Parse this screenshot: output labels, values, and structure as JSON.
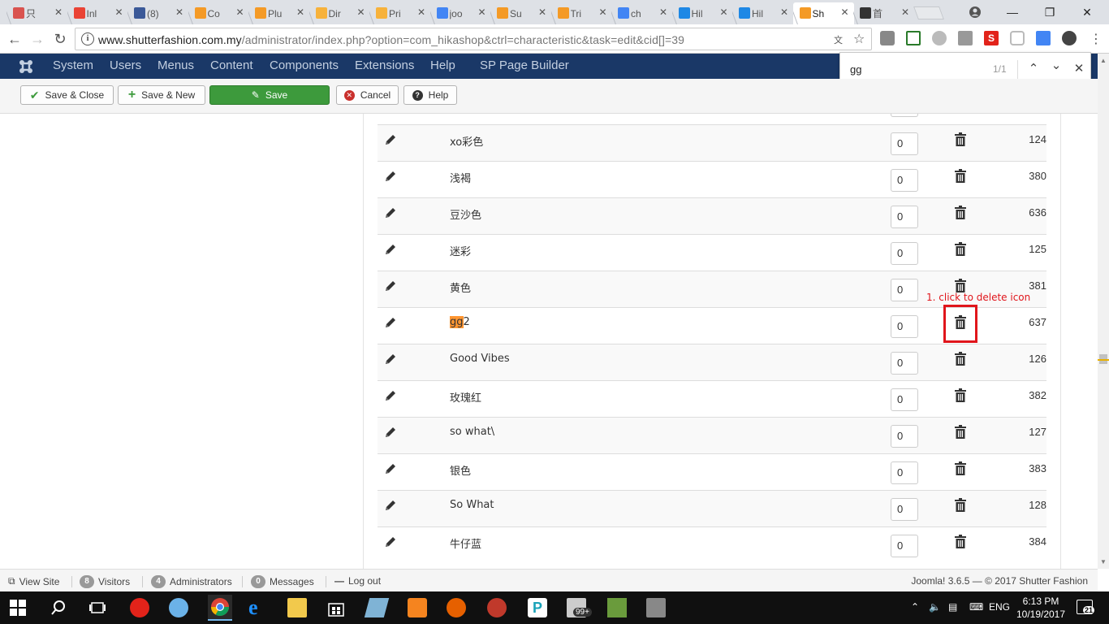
{
  "browser": {
    "tabs": [
      {
        "label": "只",
        "color": "#d9534f"
      },
      {
        "label": "Inl",
        "color": "#ea4335"
      },
      {
        "label": "(8)",
        "color": "#3b5998"
      },
      {
        "label": "Co",
        "color": "#f49a26"
      },
      {
        "label": "Plu",
        "color": "#f49a26"
      },
      {
        "label": "Dir",
        "color": "#f7b23b"
      },
      {
        "label": "Pri",
        "color": "#f7b23b"
      },
      {
        "label": "joo",
        "color": "#4285f4"
      },
      {
        "label": "Su",
        "color": "#f49a26"
      },
      {
        "label": "Tri",
        "color": "#f49a26"
      },
      {
        "label": "ch",
        "color": "#4285f4"
      },
      {
        "label": "Hil",
        "color": "#1e88e5"
      },
      {
        "label": "Hil",
        "color": "#1e88e5"
      },
      {
        "label": "Sh",
        "color": "#f49a26",
        "active": true
      },
      {
        "label": "首",
        "color": "#333333"
      }
    ],
    "url_host": "www.shutterfashion.com.my",
    "url_path": "/administrator/index.php?option=com_hikashop&ctrl=characteristic&task=edit&cid[]=39",
    "find": {
      "query": "gg",
      "count": "1/1"
    }
  },
  "admin_menu": {
    "items": [
      "System",
      "Users",
      "Menus",
      "Content",
      "Components",
      "Extensions",
      "Help",
      "SP Page Builder"
    ]
  },
  "toolbar": {
    "save_close": "Save & Close",
    "save_new": "Save & New",
    "save": "Save",
    "cancel": "Cancel",
    "help": "Help"
  },
  "values_table": {
    "rows": [
      {
        "name": "xo彩色",
        "ordering": "0",
        "id": "124"
      },
      {
        "name": "浅褐",
        "ordering": "0",
        "id": "380"
      },
      {
        "name": "豆沙色",
        "ordering": "0",
        "id": "636"
      },
      {
        "name": "迷彩",
        "ordering": "0",
        "id": "125"
      },
      {
        "name": "黄色",
        "ordering": "0",
        "id": "381"
      },
      {
        "name_highlight": "gg",
        "name_rest": "2",
        "ordering": "0",
        "id": "637"
      },
      {
        "name": "Good Vibes",
        "ordering": "0",
        "id": "126"
      },
      {
        "name": "玫瑰红",
        "ordering": "0",
        "id": "382"
      },
      {
        "name": "so what\\",
        "ordering": "0",
        "id": "127"
      },
      {
        "name": "银色",
        "ordering": "0",
        "id": "383"
      },
      {
        "name": "So What",
        "ordering": "0",
        "id": "128"
      },
      {
        "name": "牛仔蓝",
        "ordering": "0",
        "id": "384"
      }
    ]
  },
  "annotation": {
    "text": "1. click to delete  icon",
    "color": "#e0151b"
  },
  "statusbar": {
    "view_site": "View Site",
    "visitors_count": "8",
    "visitors_label": "Visitors",
    "admins_count": "4",
    "admins_label": "Administrators",
    "messages_count": "0",
    "messages_label": "Messages",
    "logout": "Log out",
    "version": "Joomla! 3.6.5  —  © 2017 Shutter Fashion"
  },
  "taskbar": {
    "lang": "ENG",
    "time": "6:13 PM",
    "date": "10/19/2017",
    "notifications": "21",
    "badge": "99+"
  },
  "colors": {
    "joomla_nav": "#1a3867",
    "save_green": "#3d9a3c",
    "find_highlight": "#ff9632"
  }
}
